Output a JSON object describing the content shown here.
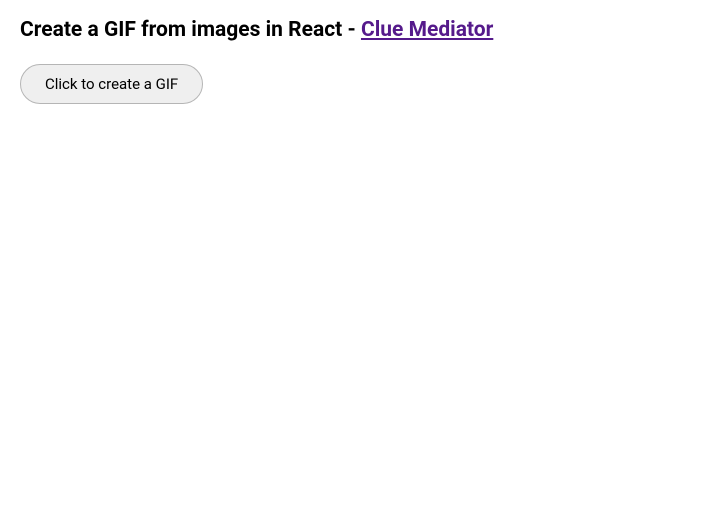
{
  "heading": {
    "prefix": "Create a GIF from images in React - ",
    "link_text": "Clue Mediator"
  },
  "button": {
    "label": "Click to create a GIF"
  }
}
